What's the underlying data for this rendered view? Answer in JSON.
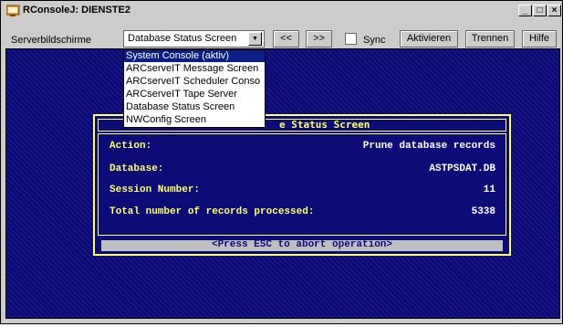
{
  "window": {
    "title": "RConsoleJ: DIENSTE2",
    "controls": {
      "minimize": "_",
      "maximize": "□",
      "close": "×"
    }
  },
  "toolbar": {
    "label": "Serverbildschirme",
    "combo_value": "Database Status Screen",
    "prev_label": "<<",
    "next_label": ">>",
    "sync_label": "Sync",
    "sync_checked": false,
    "activate_label": "Aktivieren",
    "disconnect_label": "Trennen",
    "help_label": "Hilfe"
  },
  "dropdown": {
    "items": [
      {
        "label": "System Console (aktiv)",
        "selected": true
      },
      {
        "label": "ARCserveIT Message Screen",
        "selected": false
      },
      {
        "label": "ARCserveIT Scheduler Conso",
        "selected": false
      },
      {
        "label": "ARCserveIT Tape Server",
        "selected": false
      },
      {
        "label": "Database Status Screen",
        "selected": false
      },
      {
        "label": "NWConfig Screen",
        "selected": false
      }
    ]
  },
  "dialog": {
    "title": "e Status Screen",
    "rows": [
      {
        "label": "Action:",
        "value": "Prune database records"
      },
      {
        "label": "Database:",
        "value": "ASTPSDAT.DB"
      },
      {
        "label": "Session Number:",
        "value": "11"
      },
      {
        "label": "Total number of records processed:",
        "value": "5338"
      }
    ],
    "footer": "<Press ESC to abort operation>"
  },
  "colors": {
    "console_bg": "#0b0b72",
    "dialog_text": "#ffff66",
    "selection": "#0a1e8a"
  }
}
